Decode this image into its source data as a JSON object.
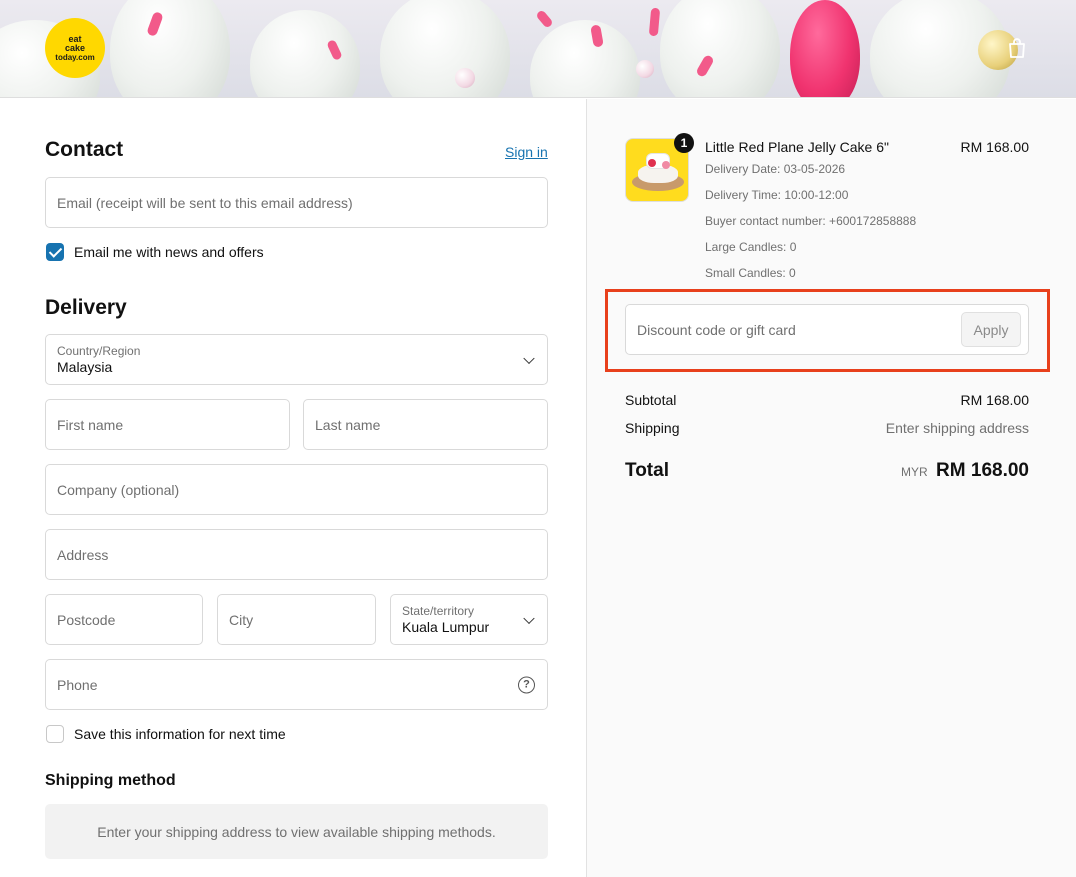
{
  "header": {
    "logo_lines": [
      "eat",
      "cake",
      "today.com"
    ],
    "cart_icon": "shopping-bag-icon"
  },
  "contact": {
    "title": "Contact",
    "sign_in": "Sign in",
    "email_placeholder": "Email (receipt will be sent to this email address)",
    "newsletter_label": "Email me with news and offers",
    "newsletter_checked": true
  },
  "delivery": {
    "title": "Delivery",
    "country_label": "Country/Region",
    "country_value": "Malaysia",
    "first_name_placeholder": "First name",
    "last_name_placeholder": "Last name",
    "company_placeholder": "Company (optional)",
    "address_placeholder": "Address",
    "postcode_placeholder": "Postcode",
    "city_placeholder": "City",
    "state_label": "State/territory",
    "state_value": "Kuala Lumpur",
    "phone_placeholder": "Phone",
    "save_info_label": "Save this information for next time",
    "save_info_checked": false
  },
  "shipping_method": {
    "title": "Shipping method",
    "message": "Enter your shipping address to view available shipping methods."
  },
  "order": {
    "quantity_badge": "1",
    "product_title": "Little Red Plane Jelly Cake 6\"",
    "product_price": "RM 168.00",
    "meta": [
      "Delivery Date: 03-05-2026",
      "Delivery Time: 10:00-12:00",
      "Buyer contact number: +600172858888",
      "Large Candles: 0",
      "Small Candles: 0"
    ],
    "discount_placeholder": "Discount code or gift card",
    "apply_label": "Apply",
    "subtotal_label": "Subtotal",
    "subtotal_value": "RM 168.00",
    "shipping_label": "Shipping",
    "shipping_value": "Enter shipping address",
    "total_label": "Total",
    "total_currency": "MYR",
    "total_value": "RM 168.00"
  },
  "colors": {
    "accent": "#1773b0",
    "highlight": "#e8401c",
    "logo_yellow": "#ffd800"
  }
}
